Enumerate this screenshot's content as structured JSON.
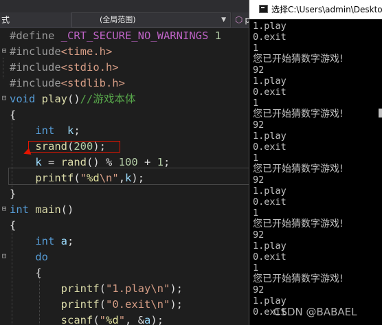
{
  "editor": {
    "nav": {
      "left_label": "式",
      "scope_label": "(全局范围)",
      "member_label": "p"
    },
    "lines": [
      [
        {
          "t": "#define ",
          "c": "pp"
        },
        {
          "t": "_CRT_SECURE_NO_WARNINGS",
          "c": "mac"
        },
        {
          "t": " 1",
          "c": "num"
        }
      ],
      [
        {
          "t": "#include",
          "c": "pp"
        },
        {
          "t": "<time.h>",
          "c": "inc"
        }
      ],
      [
        {
          "t": "#include",
          "c": "pp"
        },
        {
          "t": "<stdio.h>",
          "c": "inc"
        }
      ],
      [
        {
          "t": "#include",
          "c": "pp"
        },
        {
          "t": "<stdlib.h>",
          "c": "inc"
        }
      ],
      [
        {
          "t": "void",
          "c": "kw"
        },
        {
          "t": " "
        },
        {
          "t": "play",
          "c": "fn"
        },
        {
          "t": "()"
        },
        {
          "t": "//游戏本体",
          "c": "cm"
        }
      ],
      [
        {
          "t": "{"
        }
      ],
      [
        {
          "t": "    "
        },
        {
          "t": "int",
          "c": "kw"
        },
        {
          "t": "  "
        },
        {
          "t": "k",
          "c": "var"
        },
        {
          "t": ";"
        }
      ],
      [
        {
          "t": "    "
        },
        {
          "t": "srand",
          "c": "fn"
        },
        {
          "t": "("
        },
        {
          "t": "200",
          "c": "num"
        },
        {
          "t": ");"
        }
      ],
      [
        {
          "t": "    "
        },
        {
          "t": "k",
          "c": "var"
        },
        {
          "t": " = "
        },
        {
          "t": "rand",
          "c": "fn"
        },
        {
          "t": "() % "
        },
        {
          "t": "100",
          "c": "num"
        },
        {
          "t": " + "
        },
        {
          "t": "1",
          "c": "num"
        },
        {
          "t": ";"
        }
      ],
      [
        {
          "t": "    "
        },
        {
          "t": "printf",
          "c": "fn"
        },
        {
          "t": "("
        },
        {
          "t": "\"",
          "c": "str"
        },
        {
          "t": "%d",
          "c": "fmt"
        },
        {
          "t": "\\n\"",
          "c": "str"
        },
        {
          "t": ","
        },
        {
          "t": "k",
          "c": "var"
        },
        {
          "t": ");"
        }
      ],
      [
        {
          "t": "}"
        }
      ],
      [
        {
          "t": "int",
          "c": "kw"
        },
        {
          "t": " "
        },
        {
          "t": "main",
          "c": "fn"
        },
        {
          "t": "()"
        }
      ],
      [
        {
          "t": "{"
        }
      ],
      [
        {
          "t": "    "
        },
        {
          "t": "int",
          "c": "kw"
        },
        {
          "t": " "
        },
        {
          "t": "a",
          "c": "var"
        },
        {
          "t": ";"
        }
      ],
      [
        {
          "t": "    "
        },
        {
          "t": "do",
          "c": "kw"
        }
      ],
      [
        {
          "t": "    {"
        }
      ],
      [
        {
          "t": "        "
        },
        {
          "t": "printf",
          "c": "fn"
        },
        {
          "t": "("
        },
        {
          "t": "\"1.play\\n\"",
          "c": "str"
        },
        {
          "t": ");"
        }
      ],
      [
        {
          "t": "        "
        },
        {
          "t": "printf",
          "c": "fn"
        },
        {
          "t": "("
        },
        {
          "t": "\"0.exit\\n\"",
          "c": "str"
        },
        {
          "t": ");"
        }
      ],
      [
        {
          "t": "        "
        },
        {
          "t": "scanf",
          "c": "fn"
        },
        {
          "t": "("
        },
        {
          "t": "\"",
          "c": "str"
        },
        {
          "t": "%d",
          "c": "fmt"
        },
        {
          "t": "\"",
          "c": "str"
        },
        {
          "t": ", &"
        },
        {
          "t": "a",
          "c": "var"
        },
        {
          "t": ");"
        }
      ]
    ]
  },
  "console": {
    "title": "选择C:\\Users\\admin\\Desktop",
    "lines": [
      "1.play",
      "0.exit",
      "1",
      "您已开始猜数字游戏!",
      "92",
      "1.play",
      "0.exit",
      "1",
      "您已开始猜数字游戏!",
      "92",
      "1.play",
      "0.exit",
      "1",
      "您已开始猜数字游戏!",
      "92",
      "1.play",
      "0.exit",
      "1",
      "您已开始猜数字游戏!",
      "92",
      "1.play",
      "0.exit",
      "1",
      "您已开始猜数字游戏!",
      "92",
      "1.play",
      "0.exit"
    ]
  },
  "watermark": "CSDN @BABAEL",
  "colors": {
    "editor_bg": "#1e1e1e",
    "keyword": "#569cd6",
    "function": "#dcdcaa",
    "string": "#d69d85",
    "comment": "#57a64a",
    "macro": "#bd63c5",
    "annotation": "#e51400"
  }
}
